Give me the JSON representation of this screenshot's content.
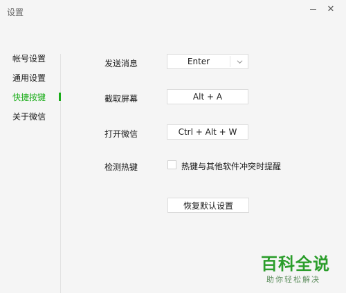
{
  "window": {
    "title": "设置"
  },
  "sidebar": {
    "items": [
      {
        "label": "帐号设置",
        "active": false
      },
      {
        "label": "通用设置",
        "active": false
      },
      {
        "label": "快捷按键",
        "active": true
      },
      {
        "label": "关于微信",
        "active": false
      }
    ]
  },
  "shortcuts": {
    "send": {
      "label": "发送消息",
      "value": "Enter"
    },
    "screenshot": {
      "label": "截取屏幕",
      "value": "Alt + A"
    },
    "open_wechat": {
      "label": "打开微信",
      "value": "Ctrl + Alt + W"
    },
    "detect": {
      "label": "检测热键",
      "checkbox_label": "热键与其他软件冲突时提醒",
      "checked": false
    },
    "reset_label": "恢复默认设置"
  },
  "watermark": {
    "main": "百科全说",
    "sub": "助你轻松解决"
  },
  "colors": {
    "accent": "#1aad19",
    "background": "#f5f5f5"
  }
}
